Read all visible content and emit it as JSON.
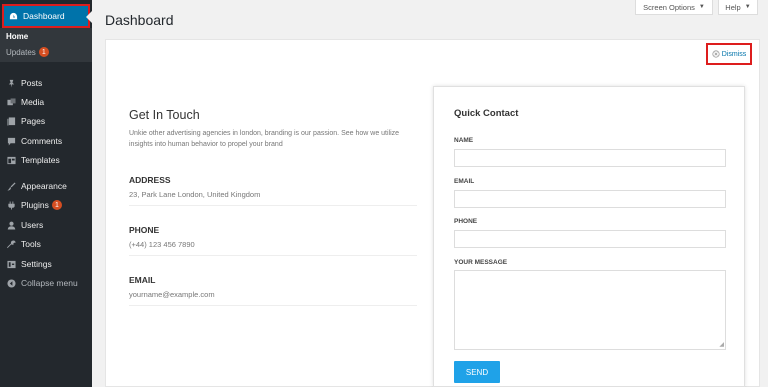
{
  "sidebar": {
    "dashboard_label": "Dashboard",
    "submenu": [
      {
        "label": "Home"
      },
      {
        "label": "Updates",
        "badge": "1"
      }
    ],
    "items": [
      {
        "label": "Posts",
        "icon": "pin-icon"
      },
      {
        "label": "Media",
        "icon": "media-icon"
      },
      {
        "label": "Pages",
        "icon": "pages-icon"
      },
      {
        "label": "Comments",
        "icon": "comments-icon"
      },
      {
        "label": "Templates",
        "icon": "templates-icon"
      },
      {
        "label": "Appearance",
        "icon": "brush-icon"
      },
      {
        "label": "Plugins",
        "icon": "plugin-icon",
        "badge": "1"
      },
      {
        "label": "Users",
        "icon": "users-icon"
      },
      {
        "label": "Tools",
        "icon": "wrench-icon"
      },
      {
        "label": "Settings",
        "icon": "settings-icon"
      },
      {
        "label": "Collapse menu",
        "icon": "collapse-icon"
      }
    ]
  },
  "header": {
    "title": "Dashboard",
    "screen_options": "Screen Options",
    "help": "Help",
    "caret": "▼"
  },
  "dismiss": {
    "label": "Dismiss"
  },
  "get_in_touch": {
    "title": "Get In Touch",
    "description": "Unkie other advertising agencies in london, branding is our passion. See how we utilize insights into human behavior to propel your brand",
    "address_label": "ADDRESS",
    "address_value": "23, Park Lane London, United Kingdom",
    "phone_label": "PHONE",
    "phone_value": "(+44) 123 456 7890",
    "email_label": "EMAIL",
    "email_value": "yourname@example.com"
  },
  "quick_contact": {
    "title": "Quick Contact",
    "name_label": "NAME",
    "email_label": "EMAIL",
    "phone_label": "PHONE",
    "message_label": "YOUR MESSAGE",
    "send_label": "SEND"
  },
  "colors": {
    "sidebar_bg": "#23282d",
    "accent": "#0073aa",
    "highlight_border": "#dd1d1d",
    "send_button": "#1fa2e8",
    "badge": "#d54e21"
  }
}
